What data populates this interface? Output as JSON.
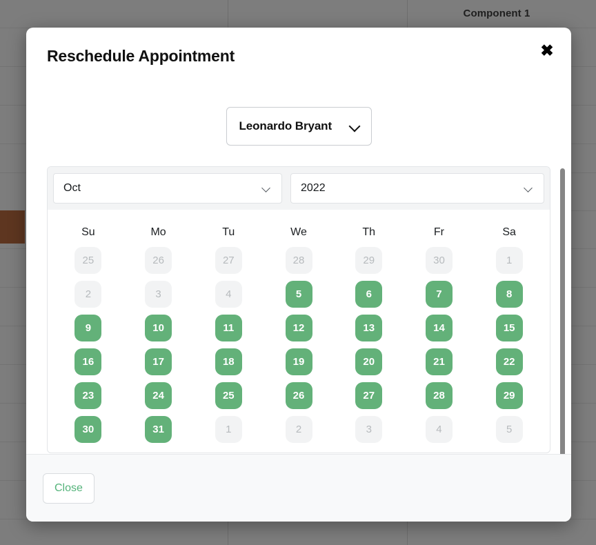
{
  "background": {
    "component_label": "Component 1"
  },
  "modal": {
    "title": "Reschedule Appointment",
    "close_icon": "close-icon",
    "close_icon_glyph": "✖",
    "person_select": {
      "value": "Leonardo Bryant",
      "chevron_icon": "chevron-down-icon"
    },
    "calendar": {
      "month": "Oct",
      "year": "2022",
      "month_chevron_icon": "chevron-down-icon",
      "year_chevron_icon": "chevron-down-icon",
      "weekdays": [
        "Su",
        "Mo",
        "Tu",
        "We",
        "Th",
        "Fr",
        "Sa"
      ],
      "weeks": [
        [
          {
            "day": "25",
            "state": "muted"
          },
          {
            "day": "26",
            "state": "muted"
          },
          {
            "day": "27",
            "state": "muted"
          },
          {
            "day": "28",
            "state": "muted"
          },
          {
            "day": "29",
            "state": "muted"
          },
          {
            "day": "30",
            "state": "muted"
          },
          {
            "day": "1",
            "state": "muted"
          }
        ],
        [
          {
            "day": "2",
            "state": "muted"
          },
          {
            "day": "3",
            "state": "muted"
          },
          {
            "day": "4",
            "state": "muted"
          },
          {
            "day": "5",
            "state": "active"
          },
          {
            "day": "6",
            "state": "active"
          },
          {
            "day": "7",
            "state": "active"
          },
          {
            "day": "8",
            "state": "active"
          }
        ],
        [
          {
            "day": "9",
            "state": "active"
          },
          {
            "day": "10",
            "state": "active"
          },
          {
            "day": "11",
            "state": "active"
          },
          {
            "day": "12",
            "state": "active"
          },
          {
            "day": "13",
            "state": "active"
          },
          {
            "day": "14",
            "state": "active"
          },
          {
            "day": "15",
            "state": "active"
          }
        ],
        [
          {
            "day": "16",
            "state": "active"
          },
          {
            "day": "17",
            "state": "active"
          },
          {
            "day": "18",
            "state": "active"
          },
          {
            "day": "19",
            "state": "active"
          },
          {
            "day": "20",
            "state": "active"
          },
          {
            "day": "21",
            "state": "active"
          },
          {
            "day": "22",
            "state": "active"
          }
        ],
        [
          {
            "day": "23",
            "state": "active"
          },
          {
            "day": "24",
            "state": "active"
          },
          {
            "day": "25",
            "state": "active"
          },
          {
            "day": "26",
            "state": "active"
          },
          {
            "day": "27",
            "state": "active"
          },
          {
            "day": "28",
            "state": "active"
          },
          {
            "day": "29",
            "state": "active"
          }
        ],
        [
          {
            "day": "30",
            "state": "active"
          },
          {
            "day": "31",
            "state": "active"
          },
          {
            "day": "1",
            "state": "muted"
          },
          {
            "day": "2",
            "state": "muted"
          },
          {
            "day": "3",
            "state": "muted"
          },
          {
            "day": "4",
            "state": "muted"
          },
          {
            "day": "5",
            "state": "muted"
          }
        ]
      ]
    },
    "footer": {
      "close_label": "Close"
    }
  },
  "colors": {
    "accent_green": "#63b179",
    "close_text_green": "#54b37a",
    "muted_day_bg": "#f2f3f4",
    "muted_day_text": "#b6babd",
    "backdrop": "#7d7d7d",
    "event_block": "#5e3620"
  }
}
